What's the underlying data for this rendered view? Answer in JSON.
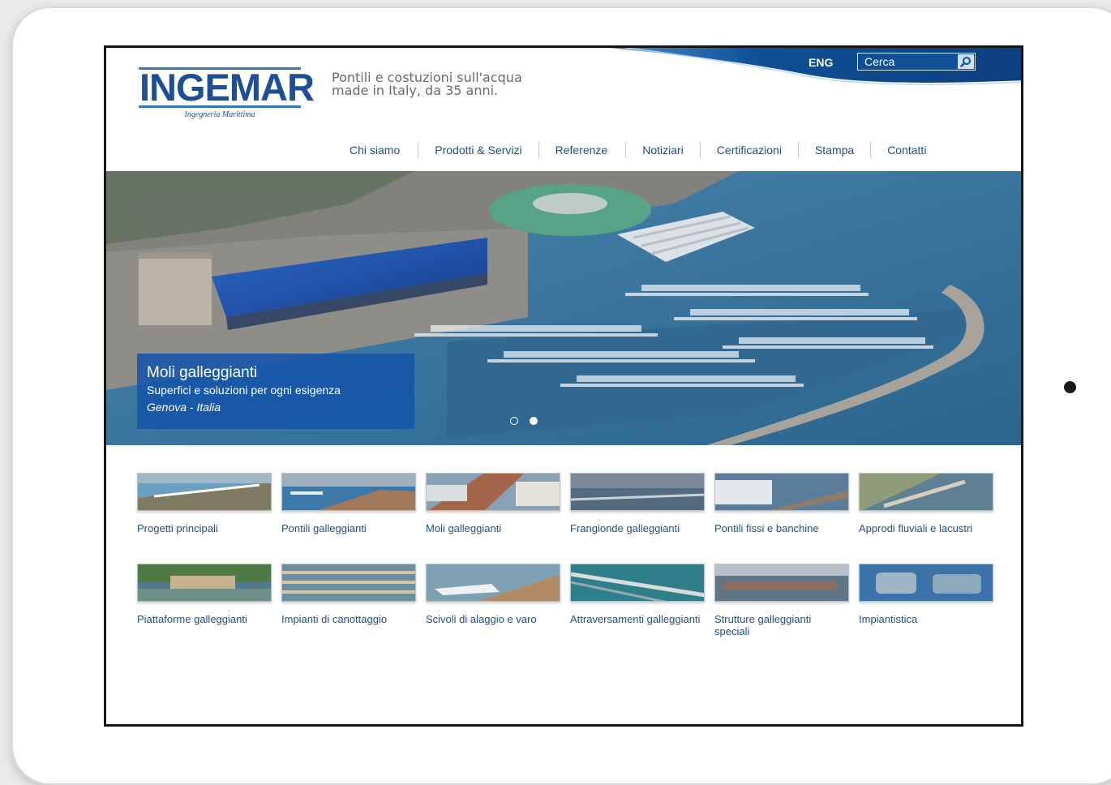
{
  "header": {
    "logo_text": "INGEMAR",
    "logo_sub": "Ingegneria Marittima",
    "tagline_line1": "Pontili e costuzioni sull'acqua",
    "tagline_line2": "made in Italy, da 35 anni.",
    "lang_label": "ENG",
    "search_placeholder": "Cerca",
    "search_icon": "search-icon"
  },
  "nav": {
    "items": [
      {
        "label": "Chi siamo"
      },
      {
        "label": "Prodotti & Servizi"
      },
      {
        "label": "Referenze"
      },
      {
        "label": "Notiziari"
      },
      {
        "label": "Certificazioni"
      },
      {
        "label": "Stampa"
      },
      {
        "label": "Contatti"
      }
    ]
  },
  "hero": {
    "title": "Moli galleggianti",
    "subtitle": "Superfici e soluzioni per ogni esigenza",
    "location": "Genova - Italia",
    "slides_count": 2,
    "active_slide": 2
  },
  "categories": [
    {
      "label": "Progetti principali"
    },
    {
      "label": "Pontili galleggianti"
    },
    {
      "label": "Moli galleggianti"
    },
    {
      "label": "Frangionde galleggianti"
    },
    {
      "label": "Pontili fissi e banchine"
    },
    {
      "label": "Approdi fluviali e lacustri"
    },
    {
      "label": "Piattaforme galleggianti"
    },
    {
      "label": "Impianti di canottaggio"
    },
    {
      "label": "Scivoli di alaggio e varo"
    },
    {
      "label": "Attraversamenti galleggianti"
    },
    {
      "label": "Strutture galleggianti speciali"
    },
    {
      "label": "Impiantistica"
    }
  ],
  "colors": {
    "brand_blue": "#1c4f95",
    "header_wave": "#0f4f95",
    "caption_bg": "#1454aa",
    "link_blue": "#1f4f89"
  }
}
